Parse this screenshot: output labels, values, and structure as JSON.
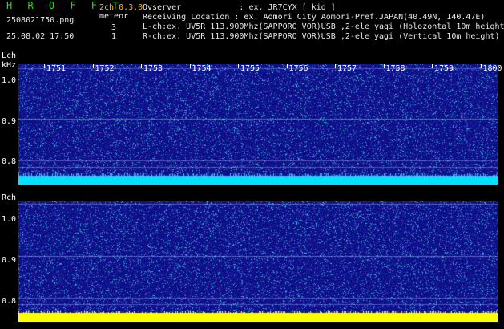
{
  "header": {
    "app_name": "H R O F F T",
    "channels": "2ch 0.3.0",
    "filename": "2508021750.png",
    "meteor_label": "meteor",
    "l_count": "3",
    "r_count": "1",
    "timestamp": "25.08.02 17:50",
    "observer": "Ovserver            : ex. JR7CYX [ kid ]",
    "location": "Receiving Location : ex. Aomori City Aomori-Pref.JAPAN(40.49N, 140.47E)",
    "lch_info": "L-ch:ex. UV5R 113.900Mhz(SAPPORO VOR)USB ,2-ele yagi (Holozontal 10m height",
    "rch_info": "R-ch:ex. UV5R 113.900Mhz(SAPPORO VOR)USB ,2-ele yagi (Vertical 10m height)"
  },
  "left_panel": {
    "label": "Lch",
    "unit": "kHz",
    "y_labels": [
      "1.0",
      "0.9",
      "0.8"
    ]
  },
  "right_panel": {
    "label": "Rch",
    "y_labels": [
      "1.0",
      "0.9",
      "0.8"
    ]
  },
  "time_ticks": [
    "1751",
    "1752",
    "1753",
    "1754",
    "1755",
    "1756",
    "1757",
    "1758",
    "1759",
    "1800"
  ],
  "colors": {
    "background": "#000000",
    "noise_low": "#10108a",
    "noise_mid": "#2f6fd8",
    "noise_high": "#26c6c6",
    "baseline_l": "#00e0ff",
    "baseline_r": "#ffff00",
    "signal_line": "#b0ffb0"
  }
}
